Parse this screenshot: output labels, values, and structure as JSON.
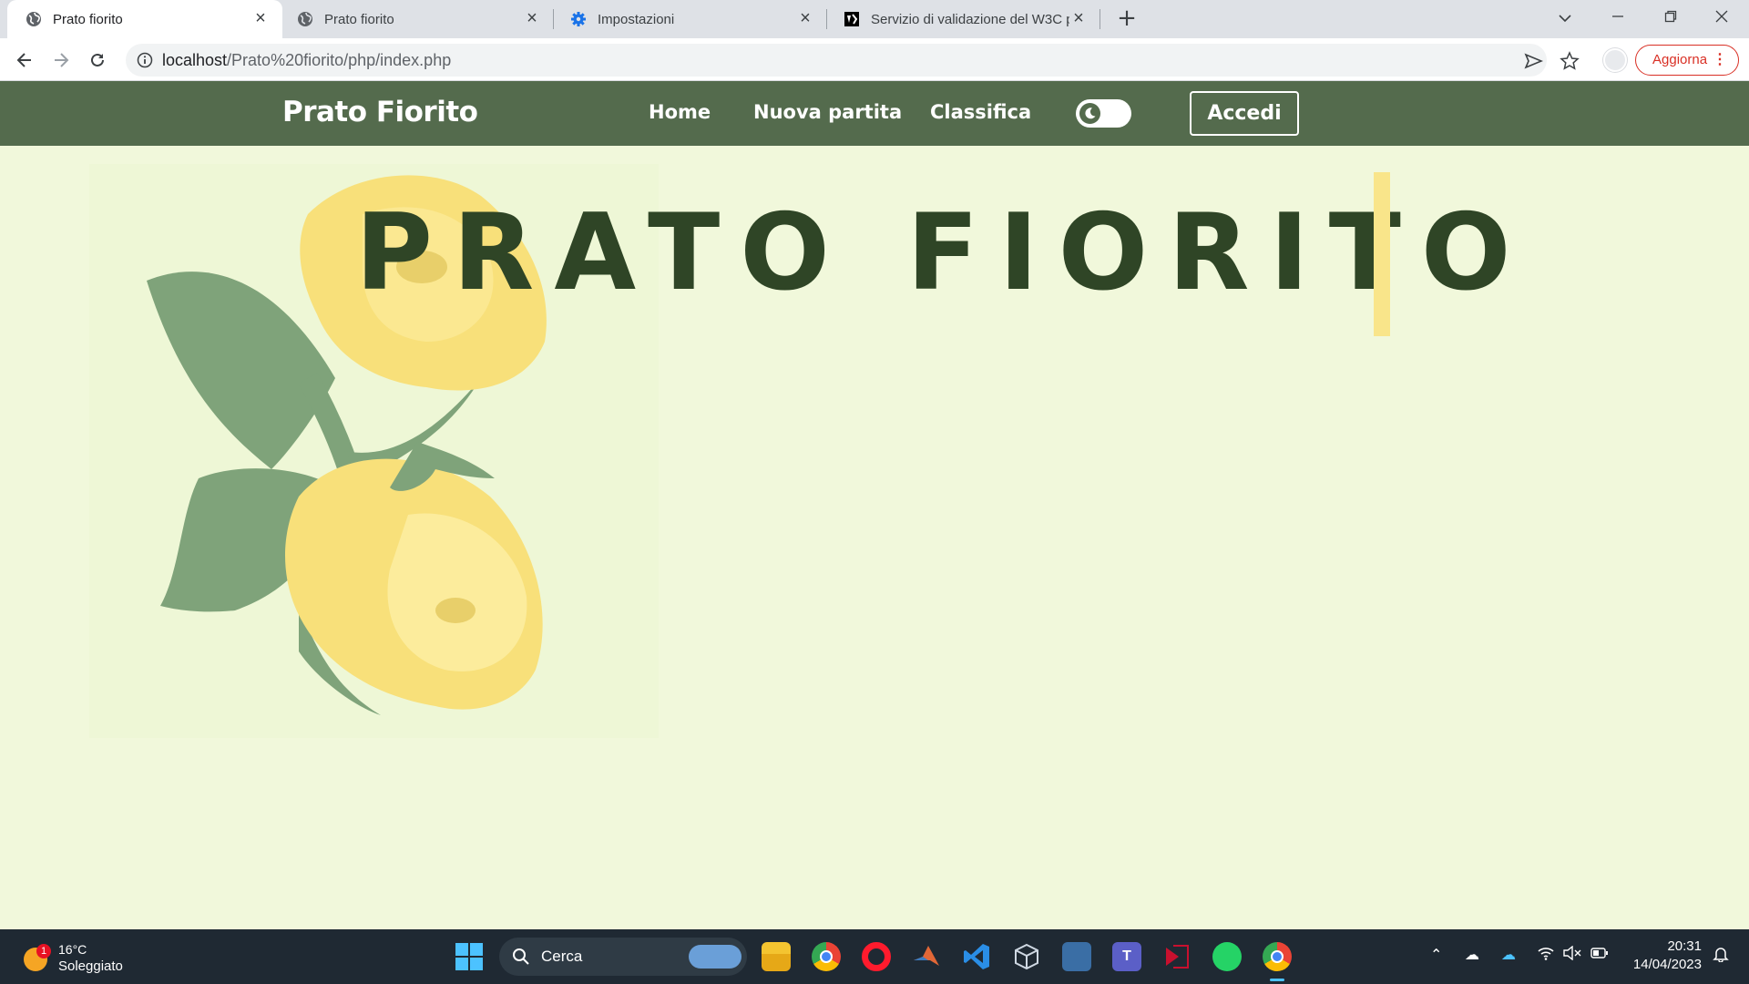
{
  "browser": {
    "tabs": [
      {
        "title": "Prato fiorito",
        "icon": "globe-icon",
        "active": true
      },
      {
        "title": "Prato fiorito",
        "icon": "globe-icon",
        "active": false
      },
      {
        "title": "Impostazioni",
        "icon": "gear-icon",
        "active": false
      },
      {
        "title": "Servizio di validazione del W3C p",
        "icon": "w3c-icon",
        "active": false
      }
    ],
    "url_host": "localhost",
    "url_path": "/Prato%20fiorito/php/index.php",
    "update_label": "Aggiorna"
  },
  "site": {
    "brand": "Prato Fiorito",
    "nav": {
      "home": "Home",
      "new_game": "Nuova partita",
      "leaderboard": "Classifica",
      "login": "Accedi"
    },
    "hero_title": "PRATO FIORITO",
    "colors": {
      "nav_bg": "#546b4d",
      "page_bg": "#f1f8db",
      "title": "#2f4526",
      "caret": "#f9e58a"
    }
  },
  "taskbar": {
    "weather_temp": "16°C",
    "weather_condition": "Soleggiato",
    "weather_badge": "1",
    "search_label": "Cerca",
    "time": "20:31",
    "date": "14/04/2023"
  }
}
